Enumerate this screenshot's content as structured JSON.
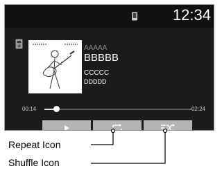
{
  "status": {
    "time": "12:34",
    "icons": [
      "phone-icon"
    ]
  },
  "source_icon": "usb-icon",
  "track": {
    "artist": "AAAAA",
    "title": "BBBBB",
    "album": "CCCCC",
    "genre": "DDDDD"
  },
  "album_art": {
    "icon": "album-art-guitarist"
  },
  "playback": {
    "elapsed": "00:14",
    "remaining": "-02:24",
    "progress_fraction": 0.08
  },
  "controls": [
    {
      "name": "play",
      "icon": "play-icon"
    },
    {
      "name": "repeat",
      "icon": "repeat-icon"
    },
    {
      "name": "shuffle",
      "icon": "shuffle-icon"
    }
  ],
  "callouts": {
    "repeat": "Repeat Icon",
    "shuffle": "Shuffle Icon"
  },
  "colors": {
    "screen": "#1b1b1b",
    "button": "#b4b4b4",
    "text": "#ffffff",
    "muted": "#8e8e8e"
  }
}
